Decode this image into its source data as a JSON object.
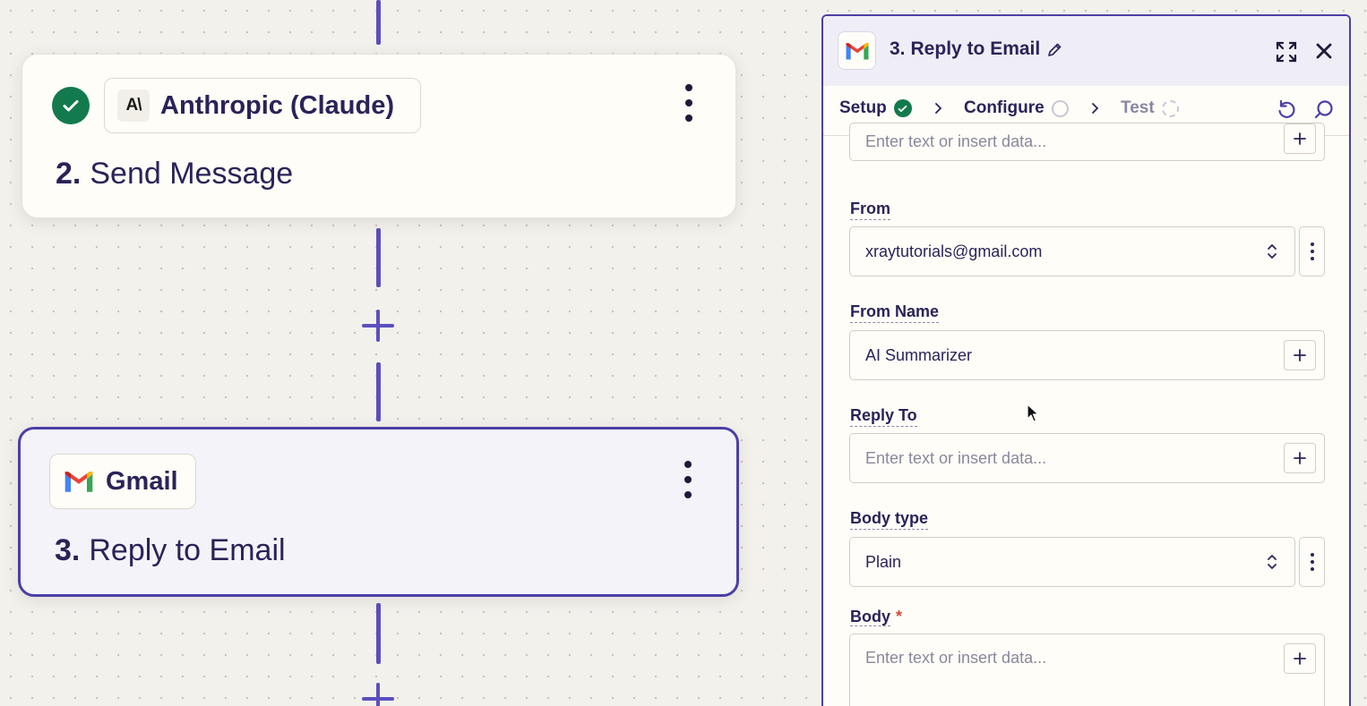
{
  "canvas": {
    "step2": {
      "app_name": "Anthropic (Claude)",
      "app_icon": "anthropic-logo",
      "app_icon_text": "A\\",
      "number": "2.",
      "title": "Send Message",
      "status": "complete"
    },
    "step3": {
      "app_name": "Gmail",
      "app_icon": "gmail-logo",
      "number": "3.",
      "title": "Reply to Email",
      "selected": true
    }
  },
  "panel": {
    "number": "3.",
    "title": "Reply to Email",
    "tabs": [
      {
        "label": "Setup",
        "status": "complete"
      },
      {
        "label": "Configure",
        "status": "in-progress",
        "active": true
      },
      {
        "label": "Test",
        "status": "pending"
      }
    ],
    "fields": {
      "top": {
        "placeholder": "Enter text or insert data..."
      },
      "from": {
        "label": "From",
        "value": "xraytutorials@gmail.com"
      },
      "from_name": {
        "label": "From Name",
        "value": "AI Summarizer"
      },
      "reply_to": {
        "label": "Reply To",
        "placeholder": "Enter text or insert data..."
      },
      "body_type": {
        "label": "Body type",
        "value": "Plain"
      },
      "body": {
        "label": "Body",
        "required_marker": "*",
        "placeholder": "Enter text or insert data..."
      }
    }
  },
  "colors": {
    "accent": "#4c3fa6",
    "success": "#137a4d",
    "required": "#d24b3e"
  }
}
